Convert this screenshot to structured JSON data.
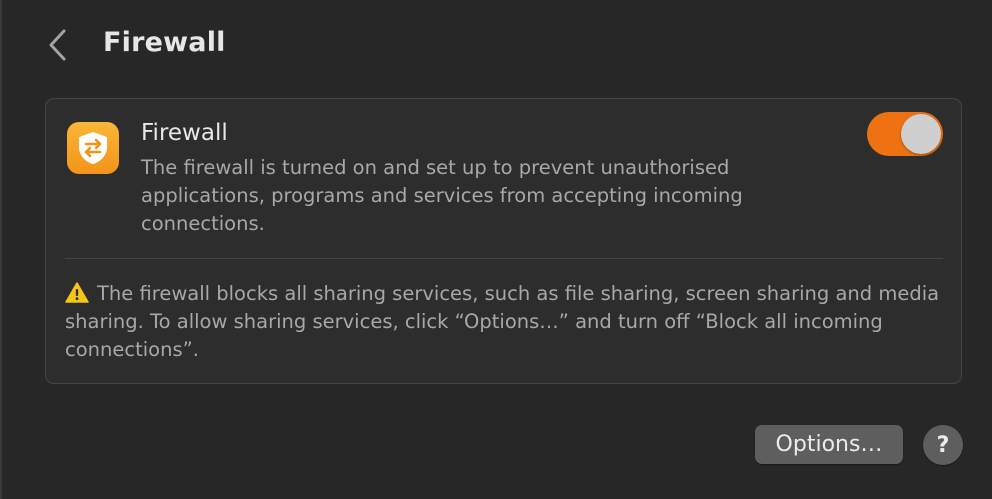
{
  "header": {
    "back_icon": "chevron-left-icon",
    "title": "Firewall"
  },
  "firewall_row": {
    "icon": "firewall-shield-icon",
    "title": "Firewall",
    "description": "The firewall is turned on and set up to prevent unauthorised applications, programs and services from accepting incoming connections.",
    "enabled": true
  },
  "warning": {
    "icon": "warning-triangle-icon",
    "text": "The firewall blocks all sharing services, such as file sharing, screen sharing and media sharing. To allow sharing services, click “Options…” and turn off “Block all incoming connections”."
  },
  "footer": {
    "options_label": "Options…",
    "help_label": "?"
  },
  "colors": {
    "background": "#272727",
    "card": "#2d2d2d",
    "accent_toggle": "#ee7112",
    "icon_gradient_top": "#fbb637",
    "icon_gradient_bottom": "#f39419",
    "button": "#5e5e5e"
  }
}
